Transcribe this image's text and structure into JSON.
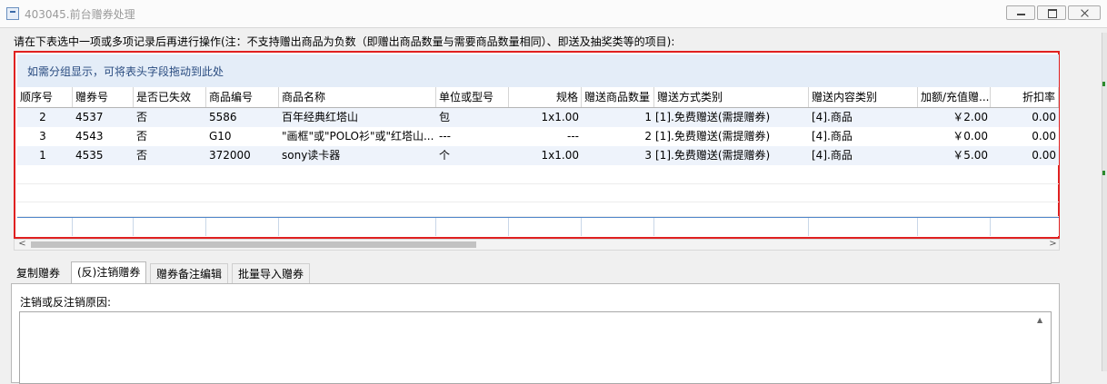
{
  "window": {
    "title": "403045.前台赠券处理"
  },
  "instruction": "请在下表选中一项或多项记录后再进行操作(注：不支持赠出商品为负数（即赠出商品数量与需要商品数量相同）、即送及抽奖类等的项目):",
  "grid": {
    "group_hint": "如需分组显示，可将表头字段拖动到此处",
    "columns": [
      "顺序号",
      "赠券号",
      "是否已失效",
      "商品编号",
      "商品名称",
      "单位或型号",
      "规格",
      "赠送商品数量",
      "赠送方式类别",
      "赠送内容类别",
      "加额/充值赠...",
      "折扣率"
    ],
    "rows": [
      [
        "2",
        "4537",
        "否",
        "5586",
        "百年经典红塔山",
        "包",
        "1x1.00",
        "1",
        "[1].免费赠送(需提赠券)",
        "[4].商品",
        "￥2.00",
        "0.00"
      ],
      [
        "3",
        "4543",
        "否",
        "G10",
        "\"画框\"或\"POLO衫\"或\"红塔山...",
        "---",
        "---",
        "2",
        "[1].免费赠送(需提赠券)",
        "[4].商品",
        "￥0.00",
        "0.00"
      ],
      [
        "1",
        "4535",
        "否",
        "372000",
        "sony读卡器",
        "个",
        "1x1.00",
        "3",
        "[1].免费赠送(需提赠券)",
        "[4].商品",
        "￥5.00",
        "0.00"
      ]
    ]
  },
  "scroll": {
    "left_arrow": "<",
    "right_arrow": ">"
  },
  "tabs": [
    "复制赠券",
    "(反)注销赠券",
    "赠券备注编辑",
    "批量导入赠券"
  ],
  "active_tab": "(反)注销赠券",
  "reason_label": "注销或反注销原因:",
  "colors": {
    "selection_border": "#e02020",
    "group_panel": "#e4edf8",
    "row_alt": "#eef3fb"
  }
}
